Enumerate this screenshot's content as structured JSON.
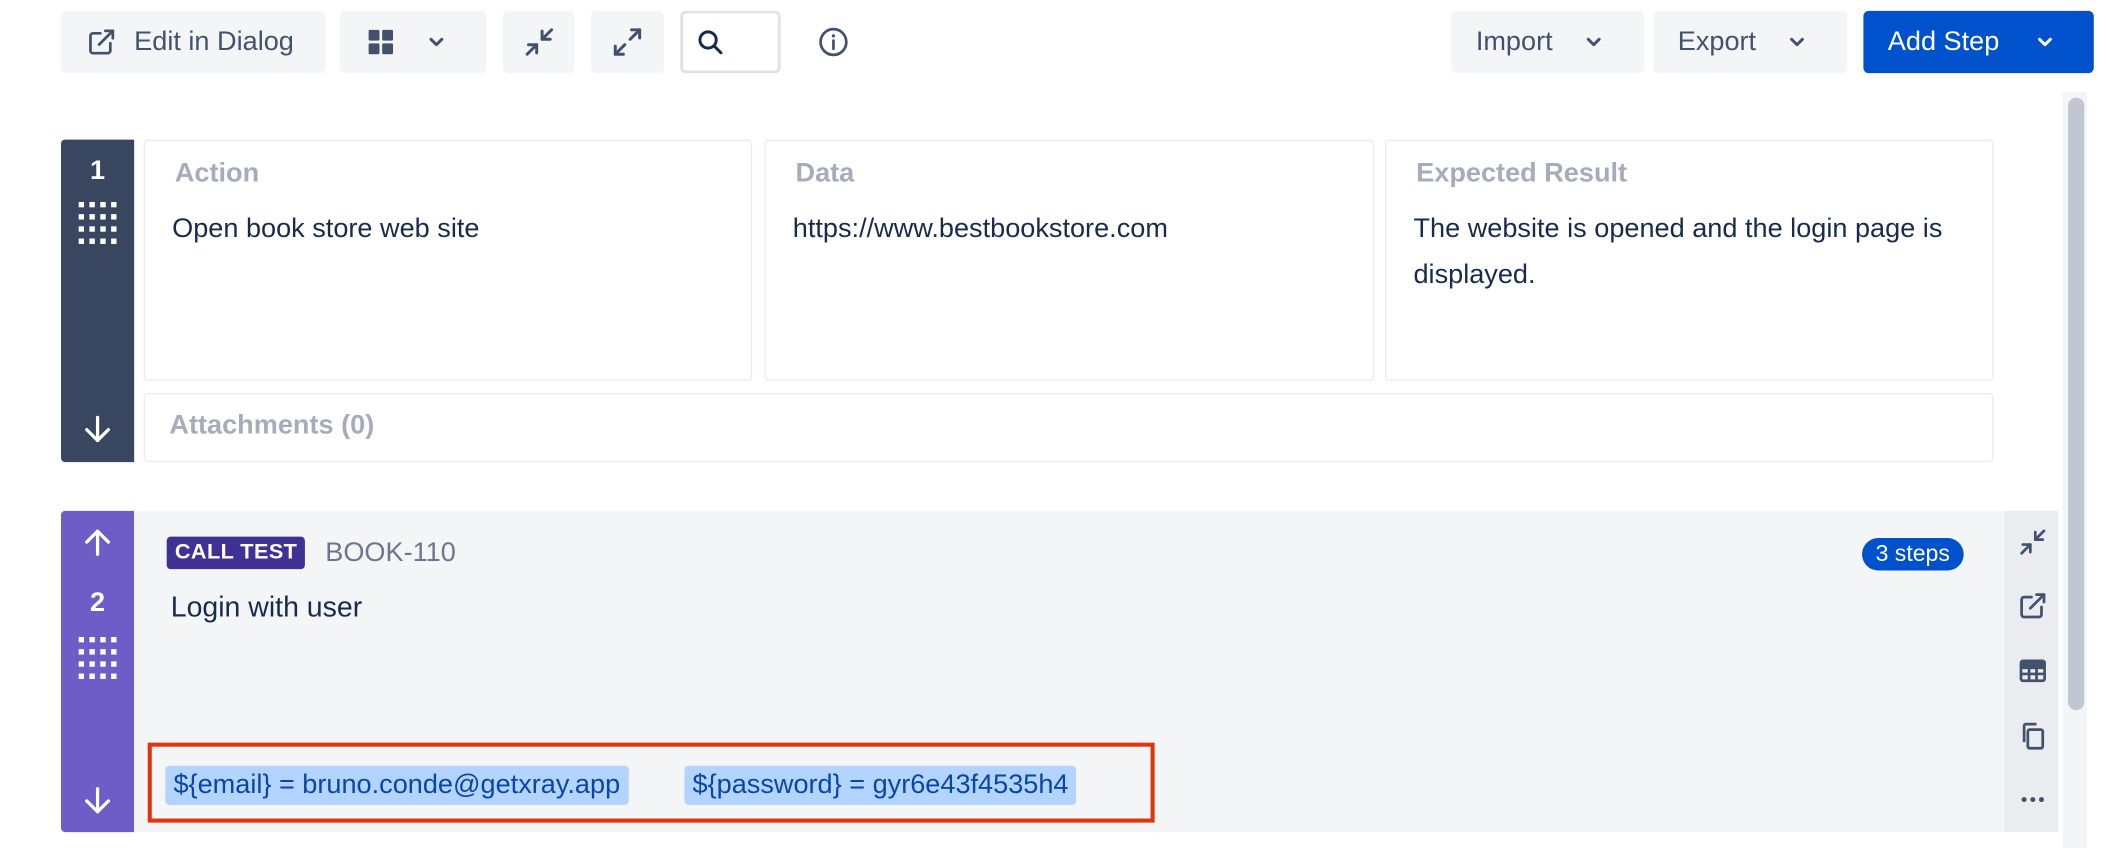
{
  "toolbar": {
    "edit_in_dialog": "Edit in Dialog",
    "import": "Import",
    "export": "Export",
    "add_step": "Add Step",
    "search_value": ""
  },
  "steps": [
    {
      "number": "1",
      "action_label": "Action",
      "action_value": "Open book store web site",
      "data_label": "Data",
      "data_value": "https://www.bestbookstore.com",
      "expected_label": "Expected Result",
      "expected_value": "The website is opened and the login page is displayed.",
      "attachments_label": "Attachments (0)"
    },
    {
      "number": "2",
      "type_lozenge": "CALL TEST",
      "called_test_key": "BOOK-110",
      "steps_badge": "3 steps",
      "summary": "Login with user",
      "parameters": [
        "${email} = bruno.conde@getxray.app",
        "${password} = gyr6e43f4535h4"
      ]
    }
  ],
  "colors": {
    "primary": "#0052cc",
    "step1_bar": "#384660",
    "step2_bar": "#6e5dc6",
    "call_test_lozenge": "#403294",
    "param_highlight": "#b3d4ff",
    "annotation_box": "#de350b"
  }
}
